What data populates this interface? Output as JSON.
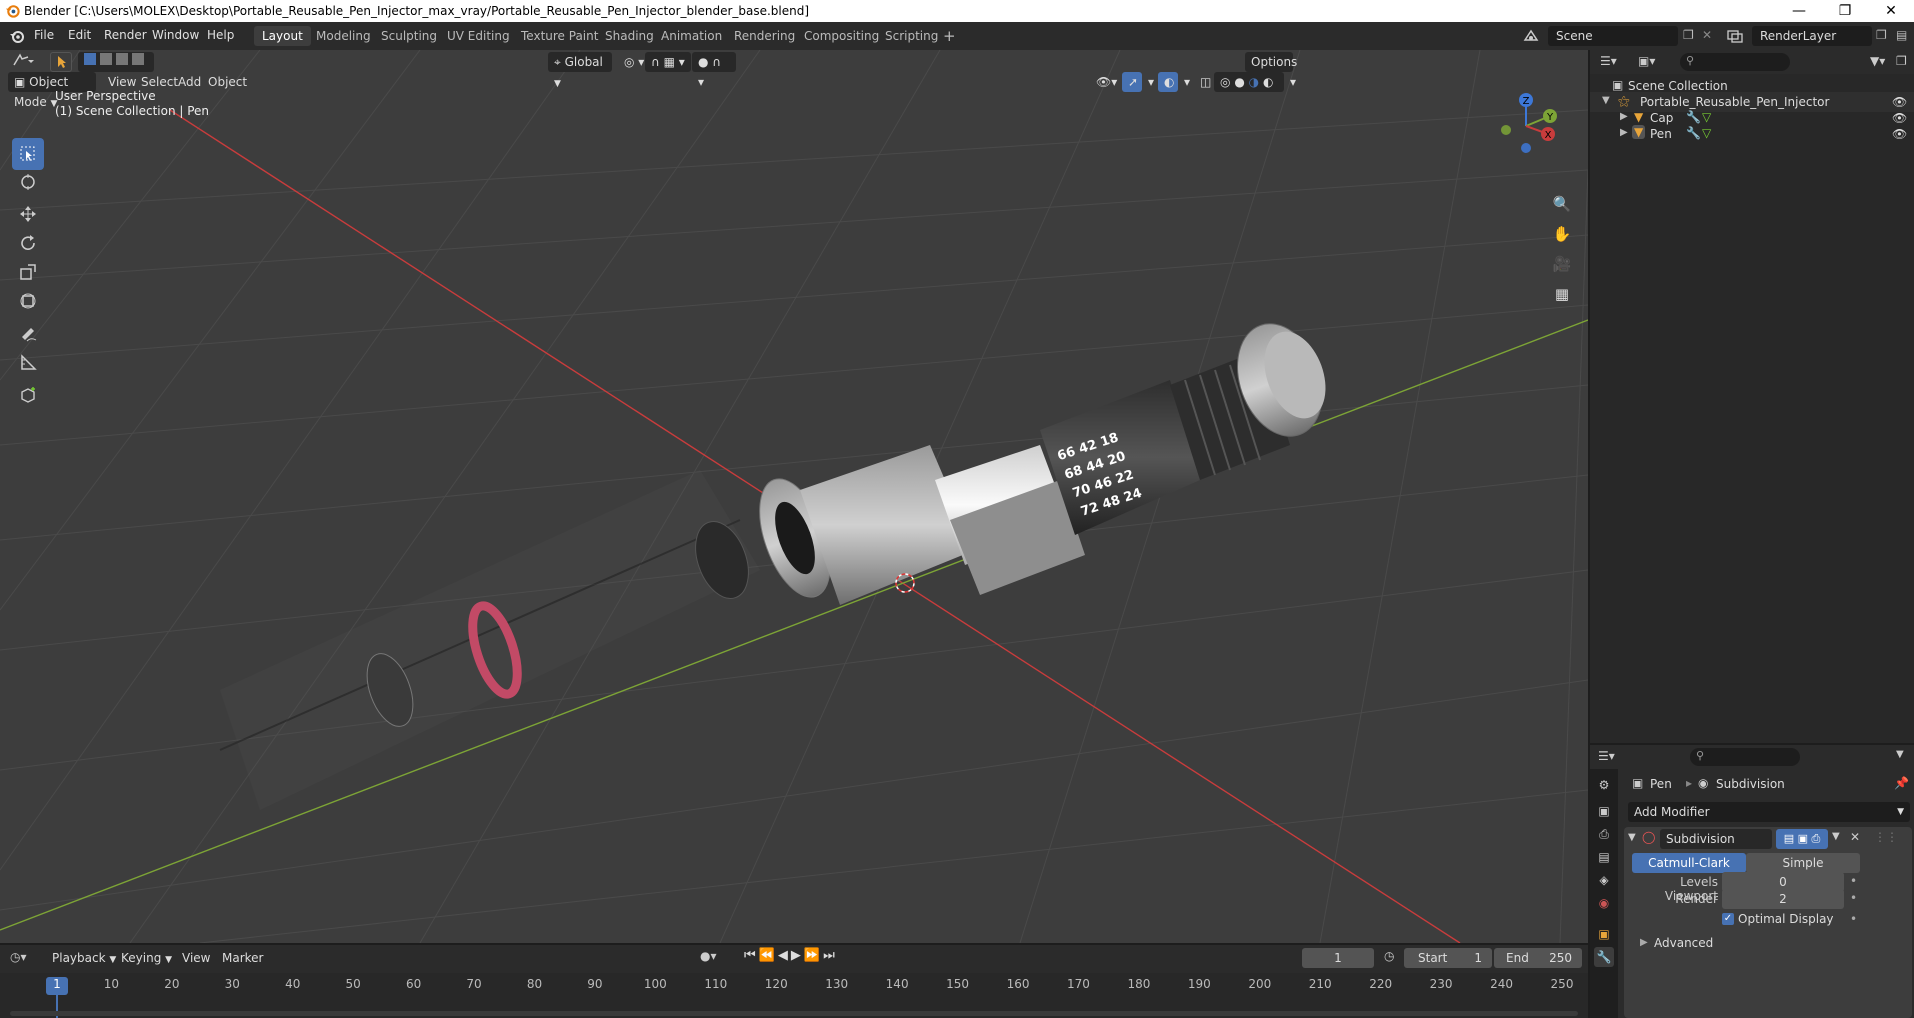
{
  "window": {
    "title": "Blender [C:\\Users\\MOLEX\\Desktop\\Portable_Reusable_Pen_Injector_max_vray/Portable_Reusable_Pen_Injector_blender_base.blend]"
  },
  "menu": [
    "File",
    "Edit",
    "Render",
    "Window",
    "Help"
  ],
  "workspaces": [
    "Layout",
    "Modeling",
    "Sculpting",
    "UV Editing",
    "Texture Paint",
    "Shading",
    "Animation",
    "Rendering",
    "Compositing",
    "Scripting"
  ],
  "active_workspace": "Layout",
  "scene": {
    "name": "Scene",
    "render_layer": "RenderLayer"
  },
  "viewport": {
    "transform_orientation": "Global",
    "options_label": "Options",
    "mode": "Object Mode",
    "header_menus": [
      "View",
      "Select",
      "Add",
      "Object"
    ],
    "overlay_title": "User Perspective",
    "overlay_subtitle": "(1) Scene Collection | Pen",
    "axes": [
      "Z",
      "Y",
      "X"
    ],
    "dial_numbers": [
      "66 42 18",
      "68 44 20",
      "70 46 22",
      "72 48 24"
    ]
  },
  "outliner": {
    "root": "Scene Collection",
    "collection": "Portable_Reusable_Pen_Injector",
    "objects": [
      "Cap",
      "Pen"
    ]
  },
  "properties": {
    "object": "Pen",
    "modifier_crumb": "Subdivision",
    "add_modifier": "Add Modifier",
    "modifier_name": "Subdivision",
    "method_options": [
      "Catmull-Clark",
      "Simple"
    ],
    "active_method": "Catmull-Clark",
    "levels_viewport_label": "Levels Viewport",
    "levels_viewport_value": "0",
    "render_label": "Render",
    "render_value": "2",
    "optimal_display_label": "Optimal Display",
    "optimal_display": true,
    "advanced_label": "Advanced"
  },
  "timeline": {
    "menus": [
      "Playback",
      "Keying",
      "View",
      "Marker"
    ],
    "current_frame": "1",
    "start_label": "Start",
    "start": "1",
    "end_label": "End",
    "end": "250",
    "ticks": [
      "1",
      "10",
      "20",
      "30",
      "40",
      "50",
      "60",
      "70",
      "80",
      "90",
      "100",
      "110",
      "120",
      "130",
      "140",
      "150",
      "160",
      "170",
      "180",
      "190",
      "200",
      "210",
      "220",
      "230",
      "240",
      "250"
    ]
  },
  "colors": {
    "accent": "#4772b3",
    "x_axis": "#c83c3c",
    "y_axis": "#7da436",
    "z_axis": "#3d78d8",
    "viewport_bg": "#3d3d3d"
  }
}
